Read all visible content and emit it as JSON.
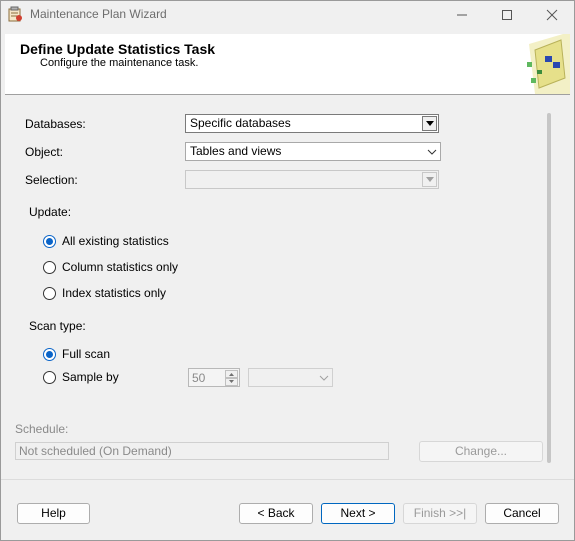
{
  "window": {
    "title": "Maintenance Plan Wizard"
  },
  "header": {
    "title": "Define Update Statistics Task",
    "subtitle": "Configure the maintenance task."
  },
  "form": {
    "databases_label": "Databases:",
    "databases_value": "Specific databases",
    "object_label": "Object:",
    "object_value": "Tables and views",
    "selection_label": "Selection:",
    "selection_value": "",
    "update_label": "Update:",
    "update_options": [
      {
        "label": "All existing statistics",
        "selected": true
      },
      {
        "label": "Column statistics only",
        "selected": false
      },
      {
        "label": "Index statistics only",
        "selected": false
      }
    ],
    "scan_label": "Scan type:",
    "scan_options": [
      {
        "label": "Full scan",
        "selected": true
      },
      {
        "label": "Sample by",
        "selected": false
      }
    ],
    "sample_value": "50",
    "sample_unit": ""
  },
  "schedule": {
    "label": "Schedule:",
    "value": "Not scheduled (On Demand)",
    "change_button": "Change..."
  },
  "footer": {
    "help": "Help",
    "back": "< Back",
    "next": "Next >",
    "finish": "Finish >>|",
    "cancel": "Cancel"
  }
}
